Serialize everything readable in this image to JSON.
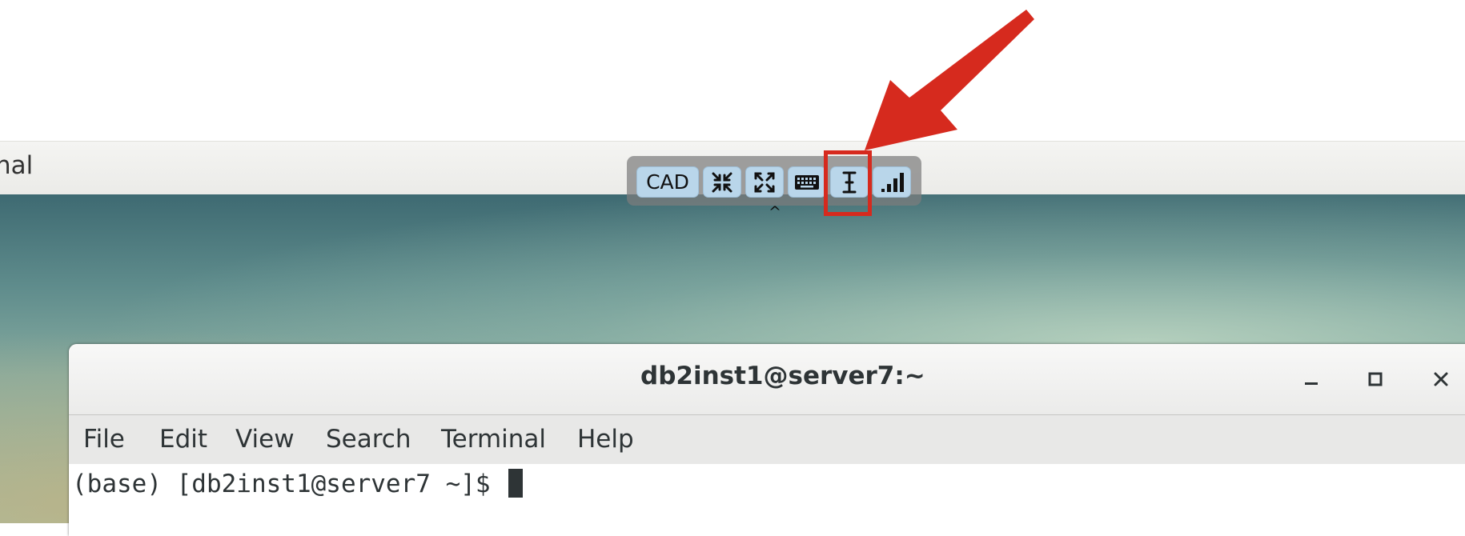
{
  "outer_window": {
    "title": "nal"
  },
  "toolbar": {
    "buttons": [
      {
        "label": "CAD",
        "icon": "text"
      },
      {
        "label": "",
        "icon": "minimize-arrows-icon"
      },
      {
        "label": "",
        "icon": "expand-arrows-icon"
      },
      {
        "label": "",
        "icon": "keyboard-icon"
      },
      {
        "label": "",
        "icon": "text-cursor-icon"
      },
      {
        "label": "",
        "icon": "signal-bars-icon"
      }
    ],
    "caret": "^",
    "highlight_color": "#d62a1e"
  },
  "terminal": {
    "title": "db2inst1@server7:~",
    "menu": [
      "File",
      "Edit",
      "View",
      "Search",
      "Terminal",
      "Help"
    ],
    "prompt": "(base) [db2inst1@server7 ~]$ "
  },
  "colors": {
    "toolbar_button": "#b9d6ea",
    "annotation": "#d62a1e"
  }
}
